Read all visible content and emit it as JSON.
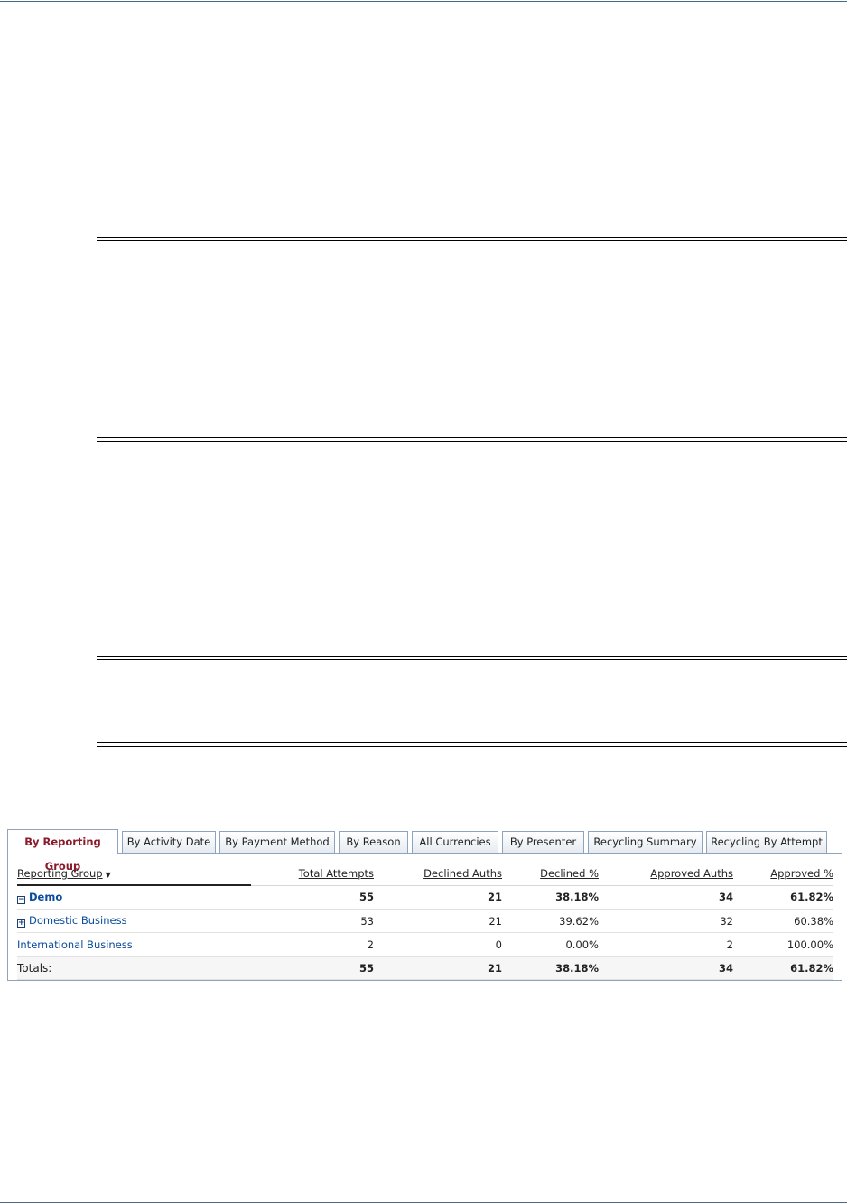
{
  "tabs": [
    {
      "label": "By Reporting Group",
      "active": true
    },
    {
      "label": "By Activity Date",
      "active": false
    },
    {
      "label": "By Payment Method",
      "active": false
    },
    {
      "label": "By Reason",
      "active": false
    },
    {
      "label": "All Currencies",
      "active": false
    },
    {
      "label": "By Presenter",
      "active": false
    },
    {
      "label": "Recycling Summary",
      "active": false
    },
    {
      "label": "Recycling By Attempt",
      "active": false
    }
  ],
  "table": {
    "columns": {
      "reporting_group": "Reporting Group",
      "total_attempts": "Total Attempts",
      "declined_auths": "Declined Auths",
      "declined_pct": "Declined %",
      "approved_auths": "Approved Auths",
      "approved_pct": "Approved %"
    },
    "sort_icon": "sort-descending-icon",
    "rows": [
      {
        "name": "Demo",
        "expander": "−",
        "total_attempts": "55",
        "declined_auths": "21",
        "declined_pct": "38.18%",
        "approved_auths": "34",
        "approved_pct": "61.82%"
      },
      {
        "name": "Domestic Business",
        "expander": "+",
        "total_attempts": "53",
        "declined_auths": "21",
        "declined_pct": "39.62%",
        "approved_auths": "32",
        "approved_pct": "60.38%"
      },
      {
        "name": "International Business",
        "total_attempts": "2",
        "declined_auths": "0",
        "declined_pct": "0.00%",
        "approved_auths": "2",
        "approved_pct": "100.00%"
      }
    ],
    "totals": {
      "label": "Totals:",
      "total_attempts": "55",
      "declined_auths": "21",
      "declined_pct": "38.18%",
      "approved_auths": "34",
      "approved_pct": "61.82%"
    }
  }
}
